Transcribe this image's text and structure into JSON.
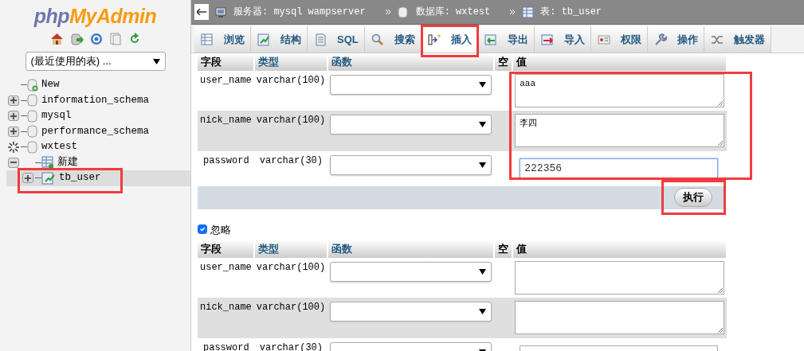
{
  "logo": {
    "part1": "php",
    "part2": "MyAdmin"
  },
  "recent_tables": {
    "value": "(最近使用的表) ..."
  },
  "tree": [
    {
      "label": "New",
      "kind": "new"
    },
    {
      "label": "information_schema",
      "kind": "db",
      "expanded": false
    },
    {
      "label": "mysql",
      "kind": "db",
      "expanded": false
    },
    {
      "label": "performance_schema",
      "kind": "db",
      "expanded": false
    },
    {
      "label": "wxtest",
      "kind": "db",
      "expanded": true,
      "loading": true,
      "children": [
        {
          "label": "新建",
          "kind": "new-table",
          "selected": false,
          "highlighted": false
        },
        {
          "label": "tb_user",
          "kind": "table",
          "selected": true,
          "highlighted": true
        }
      ]
    }
  ],
  "breadcrumb": [
    {
      "label": "服务器: mysql wampserver",
      "kind": "server"
    },
    {
      "label": "数据库: wxtest",
      "kind": "database"
    },
    {
      "label": "表: tb_user",
      "kind": "table"
    }
  ],
  "tabs": [
    {
      "label": "浏览",
      "kind": "browse",
      "selected": false,
      "highlighted": false
    },
    {
      "label": "结构",
      "kind": "structure",
      "selected": false,
      "highlighted": false
    },
    {
      "label": "SQL",
      "kind": "sql",
      "selected": false,
      "highlighted": false
    },
    {
      "label": "搜索",
      "kind": "search",
      "selected": false,
      "highlighted": false
    },
    {
      "label": "插入",
      "kind": "insert",
      "selected": true,
      "highlighted": true
    },
    {
      "label": "导出",
      "kind": "export",
      "selected": false,
      "highlighted": false
    },
    {
      "label": "导入",
      "kind": "import",
      "selected": false,
      "highlighted": false
    },
    {
      "label": "权限",
      "kind": "privileges",
      "selected": false,
      "highlighted": false
    },
    {
      "label": "操作",
      "kind": "operations",
      "selected": false,
      "highlighted": false
    },
    {
      "label": "触发器",
      "kind": "triggers",
      "selected": false,
      "highlighted": false
    }
  ],
  "forms": [
    {
      "columns": [
        "字段",
        "类型",
        "函数",
        "空",
        "值"
      ],
      "values_highlighted": true,
      "rows": [
        {
          "field": "user_name",
          "type": "varchar(100)",
          "kind": "textarea",
          "value": "aaa"
        },
        {
          "field": "nick_name",
          "type": "varchar(100)",
          "kind": "textarea",
          "value": "李四"
        },
        {
          "field": "password",
          "type": "varchar(30)",
          "kind": "input",
          "value": "222356",
          "focused": true
        }
      ],
      "execute": {
        "label": "执行",
        "highlighted": true
      }
    },
    {
      "ignore": {
        "label": "忽略",
        "checked": true
      },
      "columns": [
        "字段",
        "类型",
        "函数",
        "空",
        "值"
      ],
      "rows": [
        {
          "field": "user_name",
          "type": "varchar(100)",
          "kind": "textarea"
        },
        {
          "field": "nick_name",
          "type": "varchar(100)",
          "kind": "textarea"
        },
        {
          "field": "password",
          "type": "varchar(30)",
          "kind": "input",
          "focused": false
        }
      ]
    }
  ]
}
